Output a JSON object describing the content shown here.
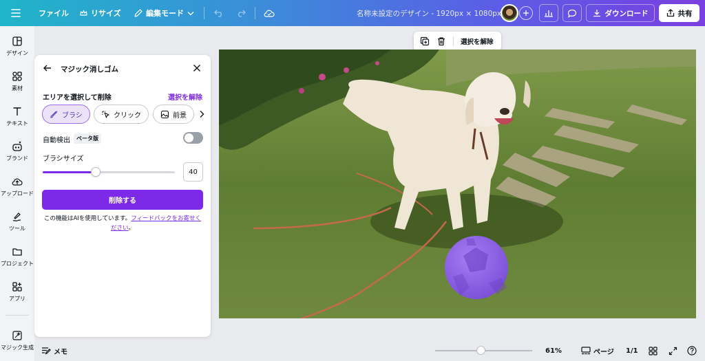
{
  "topbar": {
    "file": "ファイル",
    "resize": "リサイズ",
    "edit_mode": "編集モード",
    "doc_title": "名称未設定のデザイン - 1920px × 1080px",
    "download": "ダウンロード",
    "share": "共有",
    "gradient_colors": [
      "#1fb5c9",
      "#5b5de6",
      "#7a3fe0"
    ]
  },
  "rail": {
    "items": [
      {
        "label": "デザイン",
        "icon": "layout-icon"
      },
      {
        "label": "素材",
        "icon": "elements-icon"
      },
      {
        "label": "テキスト",
        "icon": "text-icon"
      },
      {
        "label": "ブランド",
        "icon": "brand-icon"
      },
      {
        "label": "アップロード",
        "icon": "upload-icon"
      },
      {
        "label": "ツール",
        "icon": "draw-icon"
      },
      {
        "label": "プロジェクト",
        "icon": "folder-icon"
      },
      {
        "label": "アプリ",
        "icon": "apps-icon"
      },
      {
        "label": "マジック生成",
        "icon": "magic-icon"
      }
    ]
  },
  "panel": {
    "title": "マジック消しゴム",
    "section_label": "エリアを選択して削除",
    "deselect": "選択を解除",
    "modes": [
      {
        "label": "ブラシ",
        "active": true
      },
      {
        "label": "クリック",
        "active": false
      },
      {
        "label": "前景",
        "active": false
      }
    ],
    "auto_detect": "自動検出",
    "beta": "ベータ版",
    "auto_detect_on": false,
    "brush_size_label": "ブラシサイズ",
    "brush_size": "40",
    "brush_fraction": 0.4,
    "erase_button": "削除する",
    "note_prefix": "この機能はAIを使用しています。",
    "note_link": "フィードバックをお寄せください",
    "note_suffix": "。",
    "accent": "#7d2ae8"
  },
  "float_toolbar": {
    "deselect": "選択を解除"
  },
  "bottombar": {
    "notes": "メモ",
    "zoom": "61%",
    "pages": "ページ",
    "page_count": "1/1"
  }
}
